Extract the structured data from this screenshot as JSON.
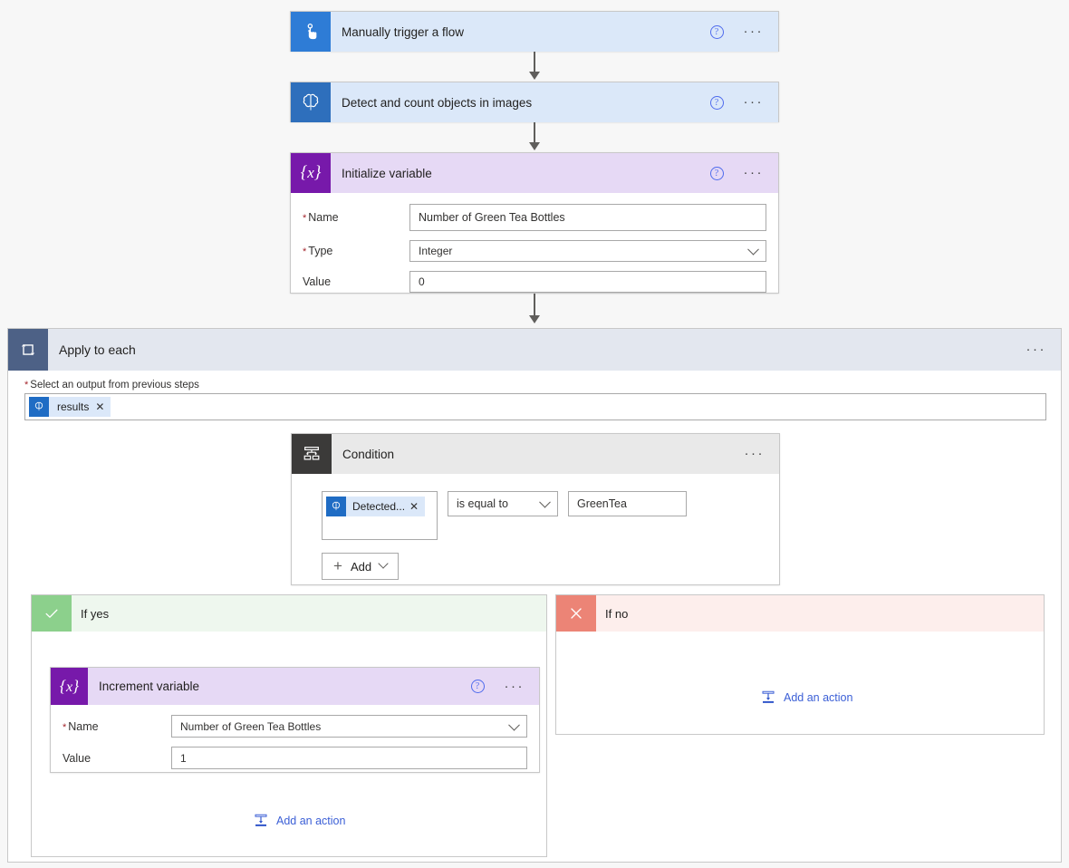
{
  "flow": {
    "trigger": {
      "title": "Manually trigger a flow",
      "icon": "touch-pointer-icon",
      "header_color": "#dbe8f9",
      "icon_bg": "#2e7cd6",
      "help_label": "?",
      "menu_label": "···"
    },
    "detect_action": {
      "title": "Detect and count objects in images",
      "icon": "brain-icon",
      "header_color": "#dbe8f9",
      "icon_bg": "#2e6fbc",
      "help_label": "?",
      "menu_label": "···"
    },
    "initialize_variable": {
      "title": "Initialize variable",
      "icon": "variable-braces-icon",
      "header_color": "#e6d9f5",
      "icon_bg": "#7719aa",
      "help_label": "?",
      "menu_label": "···",
      "fields": [
        {
          "label": "Name",
          "required": true,
          "value": "Number of Green Tea Bottles",
          "type": "text"
        },
        {
          "label": "Type",
          "required": true,
          "value": "Integer",
          "type": "dropdown"
        },
        {
          "label": "Value",
          "required": false,
          "value": "0",
          "type": "text"
        }
      ]
    },
    "apply_to_each": {
      "title": "Apply to each",
      "icon": "loop-icon",
      "header_color": "#e3e7ef",
      "icon_bg": "#4d6186",
      "menu_label": "···",
      "input_label": "Select an output from previous steps",
      "input_required": true,
      "token": {
        "text": "results",
        "icon": "brain-icon",
        "remove_label": "✕"
      }
    },
    "condition": {
      "title": "Condition",
      "icon": "condition-branch-icon",
      "header_color": "#e9e9e9",
      "icon_bg": "#3b3a39",
      "menu_label": "···",
      "left_token": {
        "text": "Detected...",
        "icon": "brain-icon",
        "remove_label": "✕"
      },
      "operator": "is equal to",
      "right_value": "GreenTea",
      "add_button_label": "Add"
    },
    "if_yes": {
      "title": "If yes",
      "icon": "checkmark-icon",
      "header_color": "#eef7ee",
      "icon_bg": "#8cd08c",
      "add_action_label": "Add an action",
      "add_action_icon": "add-action-icon",
      "action": {
        "title": "Increment variable",
        "icon": "variable-braces-icon",
        "header_color": "#e6d9f5",
        "icon_bg": "#7719aa",
        "help_label": "?",
        "menu_label": "···",
        "fields": [
          {
            "label": "Name",
            "required": true,
            "value": "Number of Green Tea Bottles",
            "type": "dropdown"
          },
          {
            "label": "Value",
            "required": false,
            "value": "1",
            "type": "text"
          }
        ]
      }
    },
    "if_no": {
      "title": "If no",
      "icon": "close-x-icon",
      "header_color": "#fdeeec",
      "icon_bg": "#ec8476",
      "add_action_label": "Add an action",
      "add_action_icon": "add-action-icon"
    }
  },
  "colors": {
    "canvas_bg": "#f7f7f7",
    "connector": "#605e5c",
    "link": "#3b5fd6",
    "required_asterisk": "#a4262c",
    "border": "#c8c8c8"
  }
}
